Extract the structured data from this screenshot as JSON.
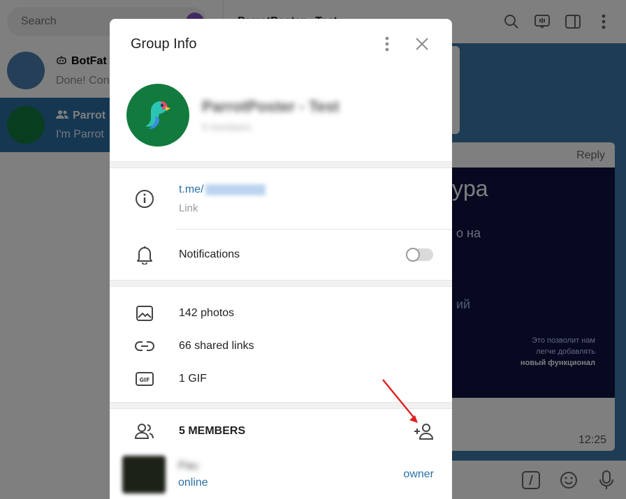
{
  "sidebar": {
    "search_placeholder": "Search",
    "chats": [
      {
        "title": "BotFat",
        "preview": "Done! Con"
      },
      {
        "title": "Parrot",
        "preview": "I'm Parrot"
      }
    ]
  },
  "chat": {
    "title": "ParrotPoster - Test",
    "card": {
      "reply_label": "Reply",
      "big_text": "ypa",
      "mid_text": "o на",
      "mid_text_2": "ий",
      "small_line_1": "Это позволит нам",
      "small_line_2": "легче добавлять",
      "small_line_3": "новый функционал",
      "time": "12:25"
    }
  },
  "modal": {
    "title": "Group Info",
    "group_name": "ParrotPoster - Test",
    "group_subtitle": "5 members",
    "link_prefix": "t.me/",
    "link_label": "Link",
    "notifications_label": "Notifications",
    "notifications_on": false,
    "media": {
      "photos": "142 photos",
      "links": "66 shared links",
      "gifs": "1 GIF"
    },
    "members_label": "5 MEMBERS",
    "members": [
      {
        "name": "Pau",
        "status": "online",
        "role": "owner"
      }
    ]
  },
  "colors": {
    "accent": "#2b6ea5",
    "group_avatar": "#137a3e",
    "arrow": "#e02020"
  },
  "icons": [
    "search-icon",
    "info-icon",
    "bell-icon",
    "photo-icon",
    "link-icon",
    "gif-icon",
    "members-icon",
    "add-member-icon",
    "more-icon",
    "close-icon"
  ]
}
